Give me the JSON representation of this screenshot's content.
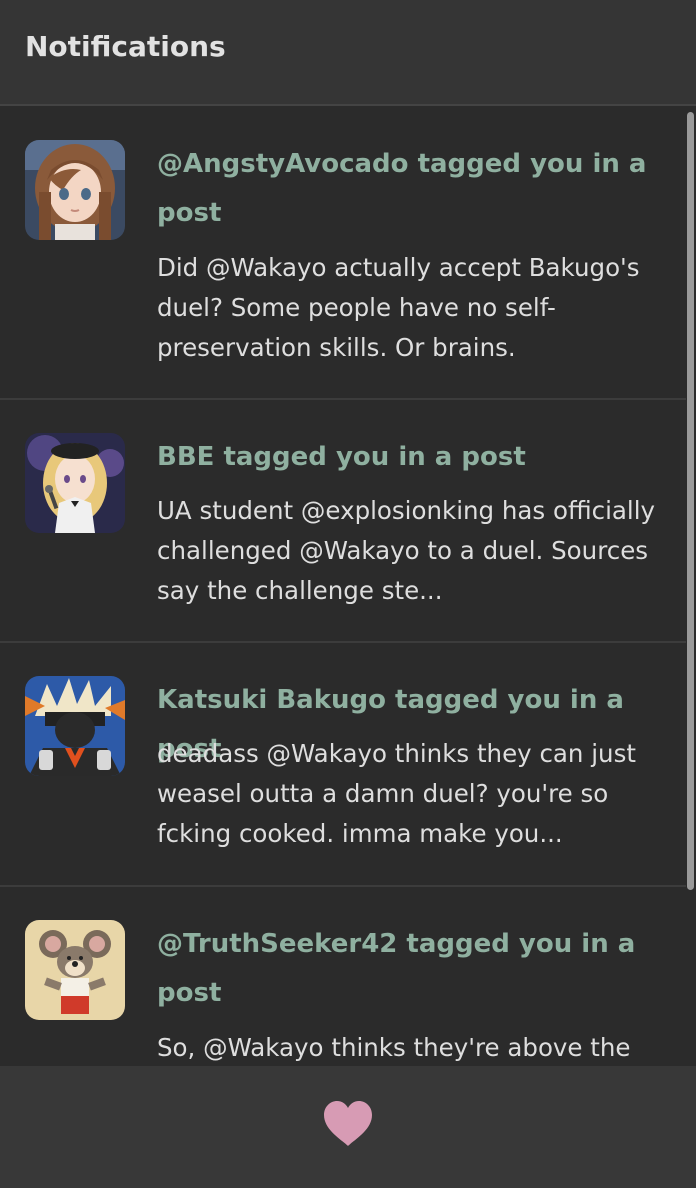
{
  "header": {
    "title": "Notifications"
  },
  "notifications": [
    {
      "title": "@AngstyAvocado tagged you in a post",
      "body": "Did @Wakayo actually accept Bakugo's duel? Some people have no self-preservation skills. Or brains.",
      "avatar": "girl-brown-hair-avatar"
    },
    {
      "title": "BBE tagged you in a post",
      "body": "UA student @explosionking has officially challenged @Wakayo to a duel. Sources say the challenge ste...",
      "avatar": "blonde-singer-avatar"
    },
    {
      "title": "Katsuki Bakugo tagged you in a post",
      "body": "deadass @Wakayo thinks they can just weasel outta a damn duel? you're so fcking cooked. imma make you...",
      "avatar": "spiky-hair-hero-avatar"
    },
    {
      "title": "@TruthSeeker42 tagged you in a post",
      "body": "So, @Wakayo thinks they're above the",
      "avatar": "cartoon-mouse-avatar"
    }
  ],
  "footer": {
    "icon": "heart-icon"
  },
  "colors": {
    "accent_title": "#8fb0a0",
    "heart": "#d79bb4",
    "background": "#2b2b2b",
    "header_bg": "#353535"
  }
}
